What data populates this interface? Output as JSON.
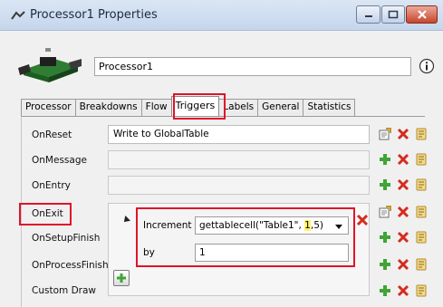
{
  "window": {
    "title": "Processor1 Properties",
    "controls": {
      "minimize": "minimize",
      "maximize": "maximize",
      "close": "close"
    }
  },
  "header": {
    "object_name": "Processor1",
    "image_icon": "processor-model-icon",
    "info_icon": "info-icon"
  },
  "tabs": [
    {
      "label": "Processor",
      "active": false
    },
    {
      "label": "Breakdowns",
      "active": false
    },
    {
      "label": "Flow",
      "active": false
    },
    {
      "label": "Triggers",
      "active": true
    },
    {
      "label": "Labels",
      "active": false
    },
    {
      "label": "General",
      "active": false
    },
    {
      "label": "Statistics",
      "active": false
    }
  ],
  "triggers": [
    {
      "label": "OnReset",
      "value": "Write to GlobalTable"
    },
    {
      "label": "OnMessage",
      "value": ""
    },
    {
      "label": "OnEntry",
      "value": ""
    },
    {
      "label": "OnExit",
      "value": ""
    },
    {
      "label": "OnSetupFinish",
      "value": ""
    },
    {
      "label": "OnProcessFinish",
      "value": ""
    },
    {
      "label": "Custom Draw",
      "value": ""
    }
  ],
  "onexit_params": {
    "increment_label": "Increment",
    "increment_value_pre": "gettablecell(\"Table1\", ",
    "increment_value_hl": "1",
    "increment_value_post": ",5)",
    "by_label": "by",
    "by_value": "1"
  },
  "colors": {
    "highlight_border": "#e0132a",
    "highlight_text": "#fff36b",
    "delete_red": "#d52b1e",
    "add_green": "#3fa535"
  }
}
